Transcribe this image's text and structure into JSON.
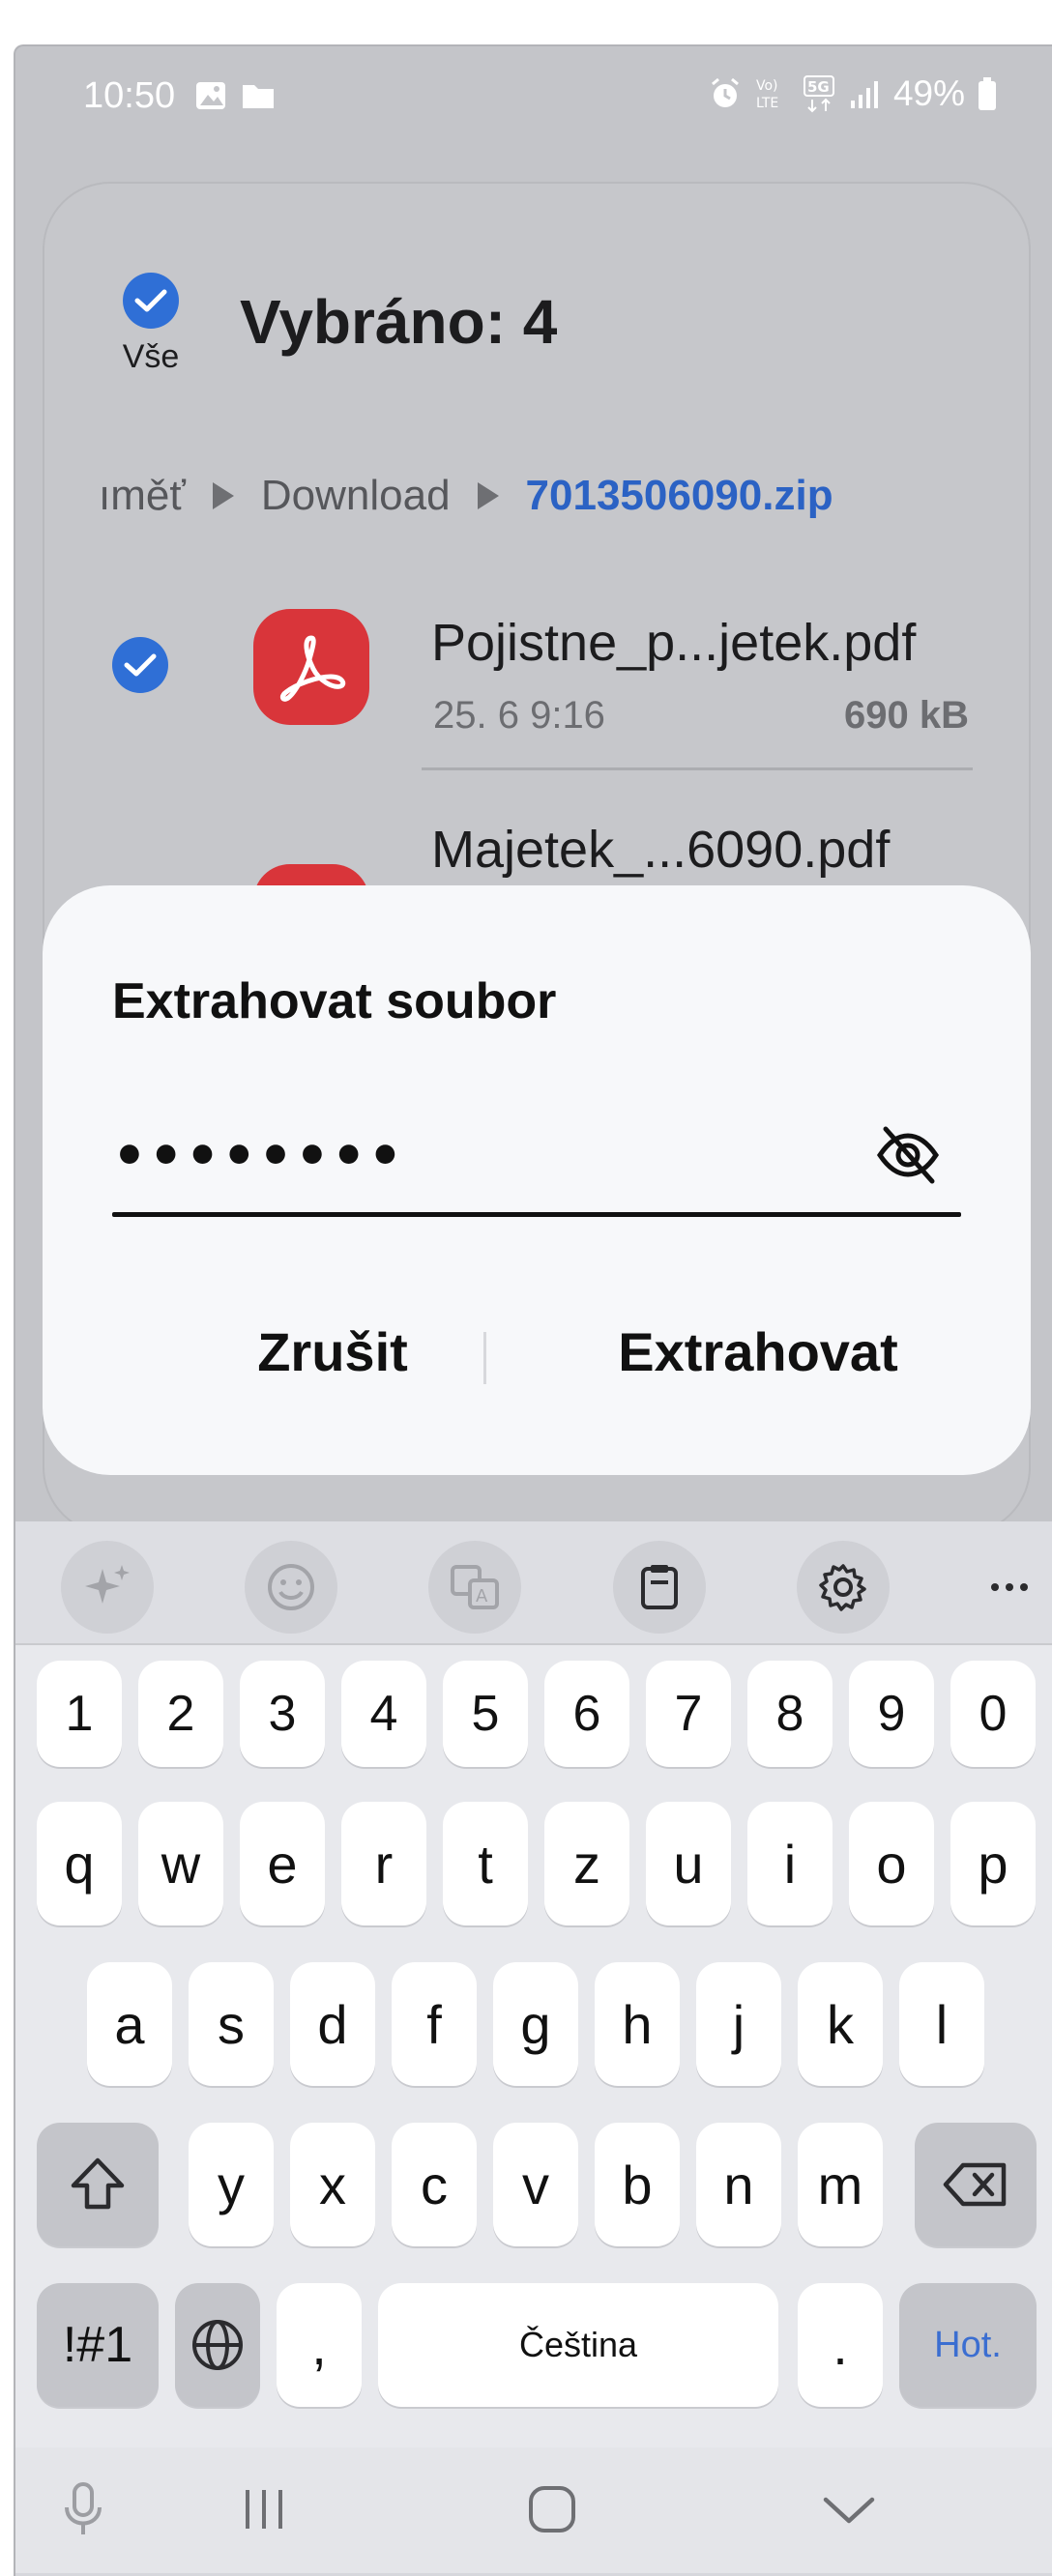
{
  "status_bar": {
    "time": "10:50",
    "battery": "49%",
    "network": "5G"
  },
  "header": {
    "select_all_label": "Vše",
    "title": "Vybráno: 4"
  },
  "breadcrumb": {
    "partial": "ıměť",
    "folder": "Download",
    "current": "7013506090.zip"
  },
  "files": [
    {
      "name": "Pojistne_p...jetek.pdf",
      "date": "25. 6 9:16",
      "size": "690 kB"
    },
    {
      "name": "Majetek_...6090.pdf"
    }
  ],
  "dialog": {
    "title": "Extrahovat soubor",
    "password_value": "••••••••",
    "cancel_label": "Zrušit",
    "extract_label": "Extrahovat"
  },
  "keyboard": {
    "numbers": [
      "1",
      "2",
      "3",
      "4",
      "5",
      "6",
      "7",
      "8",
      "9",
      "0"
    ],
    "row1": [
      "q",
      "w",
      "e",
      "r",
      "t",
      "z",
      "u",
      "i",
      "o",
      "p"
    ],
    "row2": [
      "a",
      "s",
      "d",
      "f",
      "g",
      "h",
      "j",
      "k",
      "l"
    ],
    "row3": [
      "y",
      "x",
      "c",
      "v",
      "b",
      "n",
      "m"
    ],
    "symbols_label": "!#1",
    "comma": ",",
    "space_label": "Čeština",
    "period": ".",
    "done_label": "Hot."
  },
  "colors": {
    "accent": "#2f6fd6",
    "pdf": "#d9353a",
    "link": "#2b62c4"
  }
}
